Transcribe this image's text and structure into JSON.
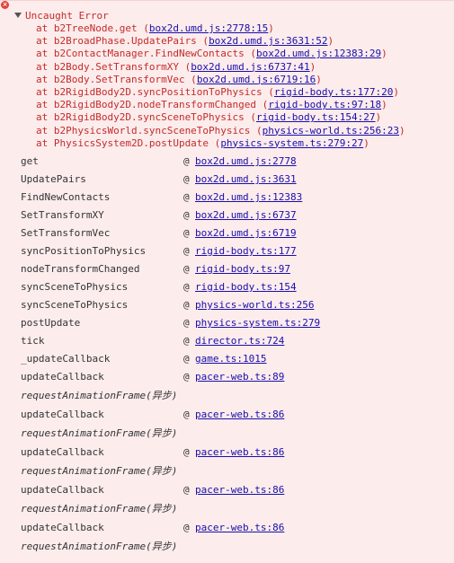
{
  "error": {
    "icon": "error-circle-icon",
    "title": "Uncaught Error",
    "trace": [
      {
        "text": "at b2TreeNode.get (",
        "link": "box2d.umd.js:2778:15",
        "close": ")"
      },
      {
        "text": "at b2BroadPhase.UpdatePairs (",
        "link": "box2d.umd.js:3631:52",
        "close": ")"
      },
      {
        "text": "at b2ContactManager.FindNewContacts (",
        "link": "box2d.umd.js:12383:29",
        "close": ")"
      },
      {
        "text": "at b2Body.SetTransformXY (",
        "link": "box2d.umd.js:6737:41",
        "close": ")"
      },
      {
        "text": "at b2Body.SetTransformVec (",
        "link": "box2d.umd.js:6719:16",
        "close": ")"
      },
      {
        "text": "at b2RigidBody2D.syncPositionToPhysics (",
        "link": "rigid-body.ts:177:20",
        "close": ")"
      },
      {
        "text": "at b2RigidBody2D.nodeTransformChanged (",
        "link": "rigid-body.ts:97:18",
        "close": ")"
      },
      {
        "text": "at b2RigidBody2D.syncSceneToPhysics (",
        "link": "rigid-body.ts:154:27",
        "close": ")"
      },
      {
        "text": "at b2PhysicsWorld.syncSceneToPhysics (",
        "link": "physics-world.ts:256:23",
        "close": ")"
      },
      {
        "text": "at PhysicsSystem2D.postUpdate (",
        "link": "physics-system.ts:279:27",
        "close": ")"
      }
    ]
  },
  "frames": {
    "at_symbol": "@",
    "rows": [
      {
        "type": "frame",
        "fn": "get",
        "link": "box2d.umd.js:2778"
      },
      {
        "type": "frame",
        "fn": "UpdatePairs",
        "link": "box2d.umd.js:3631"
      },
      {
        "type": "frame",
        "fn": "FindNewContacts",
        "link": "box2d.umd.js:12383"
      },
      {
        "type": "frame",
        "fn": "SetTransformXY",
        "link": "box2d.umd.js:6737"
      },
      {
        "type": "frame",
        "fn": "SetTransformVec",
        "link": "box2d.umd.js:6719"
      },
      {
        "type": "frame",
        "fn": "syncPositionToPhysics",
        "link": "rigid-body.ts:177"
      },
      {
        "type": "frame",
        "fn": "nodeTransformChanged",
        "link": "rigid-body.ts:97"
      },
      {
        "type": "frame",
        "fn": "syncSceneToPhysics",
        "link": "rigid-body.ts:154"
      },
      {
        "type": "frame",
        "fn": "syncSceneToPhysics",
        "link": "physics-world.ts:256"
      },
      {
        "type": "frame",
        "fn": "postUpdate",
        "link": "physics-system.ts:279"
      },
      {
        "type": "frame",
        "fn": "tick",
        "link": "director.ts:724"
      },
      {
        "type": "frame",
        "fn": "_updateCallback",
        "link": "game.ts:1015"
      },
      {
        "type": "frame",
        "fn": "updateCallback",
        "link": "pacer-web.ts:89"
      },
      {
        "type": "async",
        "text": "requestAnimationFrame(异步)"
      },
      {
        "type": "frame",
        "fn": "updateCallback",
        "link": "pacer-web.ts:86"
      },
      {
        "type": "async",
        "text": "requestAnimationFrame(异步)"
      },
      {
        "type": "frame",
        "fn": "updateCallback",
        "link": "pacer-web.ts:86"
      },
      {
        "type": "async",
        "text": "requestAnimationFrame(异步)"
      },
      {
        "type": "frame",
        "fn": "updateCallback",
        "link": "pacer-web.ts:86"
      },
      {
        "type": "async",
        "text": "requestAnimationFrame(异步)"
      },
      {
        "type": "frame",
        "fn": "updateCallback",
        "link": "pacer-web.ts:86"
      },
      {
        "type": "async",
        "text": "requestAnimationFrame(异步)"
      }
    ]
  },
  "colors": {
    "background": "#fcecec",
    "error_text": "#c42b2b",
    "link": "#1a0dab",
    "icon": "#e0443a"
  }
}
